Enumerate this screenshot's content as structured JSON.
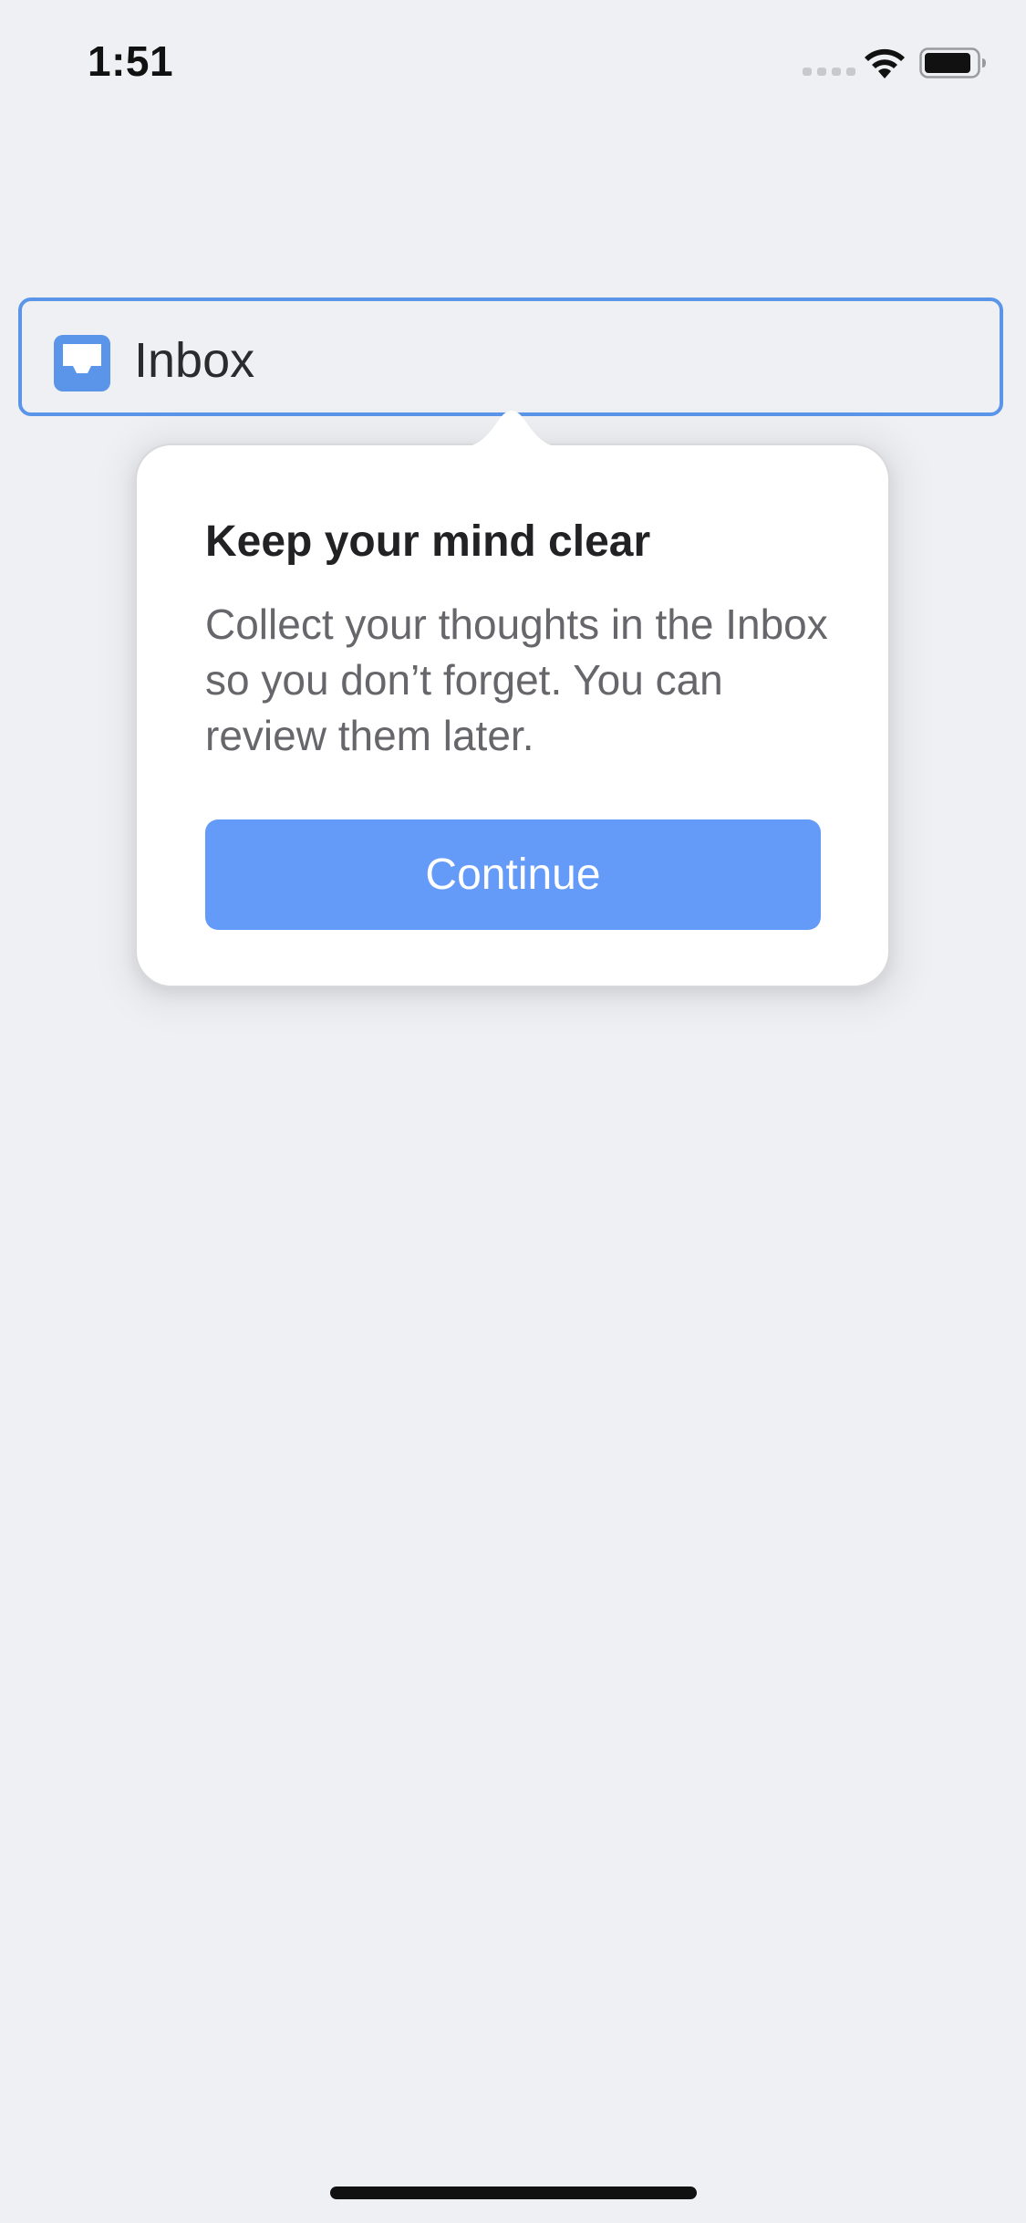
{
  "status_bar": {
    "time": "1:51",
    "icons": [
      "cellular-signal-icon",
      "wifi-icon",
      "battery-icon"
    ]
  },
  "inbox": {
    "label": "Inbox",
    "icon": "inbox-tray-icon",
    "accent_color": "#5B95E9"
  },
  "popover": {
    "title": "Keep your mind clear",
    "body": "Collect your thoughts in the Inbox so you don’t forget. You can review them later.",
    "button_label": "Continue",
    "button_color": "#659BF8"
  },
  "colors": {
    "background": "#EFF0F3",
    "text_primary": "#222224",
    "text_secondary": "#66666B"
  }
}
